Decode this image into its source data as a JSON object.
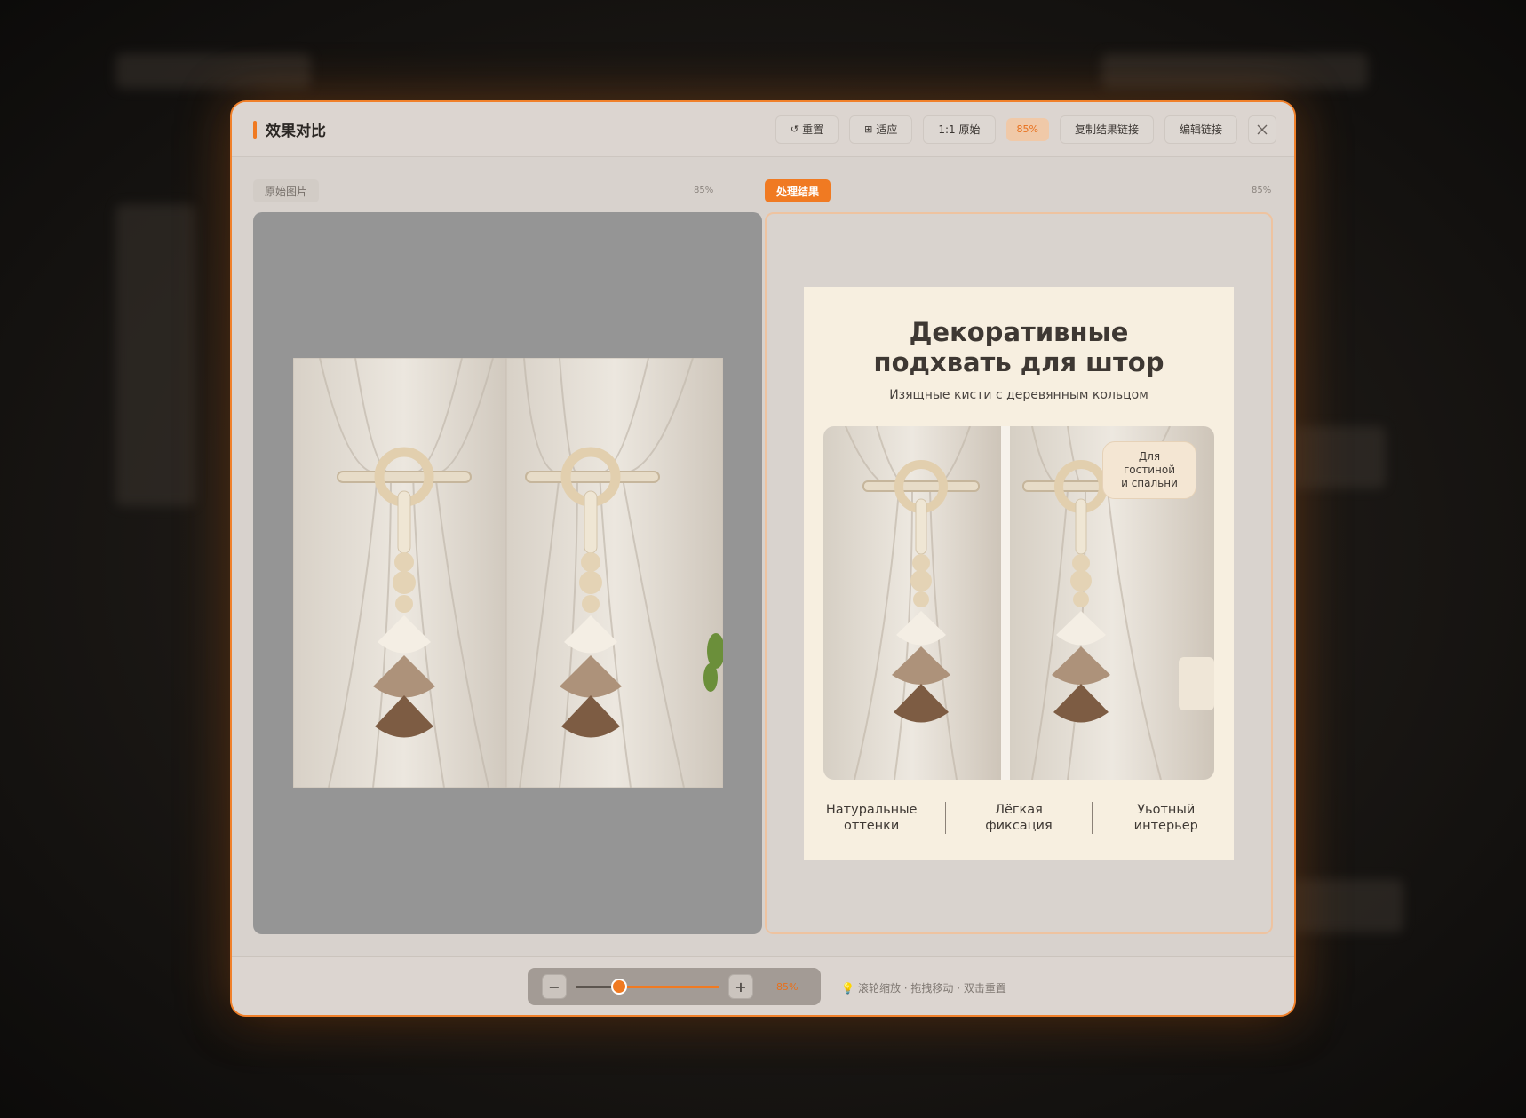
{
  "modal": {
    "title": "效果对比",
    "toolbar": {
      "reset_label": "重置",
      "fit_label": "适应",
      "actual_label": "1:1 原始",
      "zoom_display": "85%",
      "copy_link_label": "复制结果链接",
      "edit_link_label": "编辑链接"
    }
  },
  "panels": {
    "original": {
      "label": "原始图片",
      "zoom": "85%"
    },
    "result": {
      "label": "处理结果",
      "zoom": "85%"
    }
  },
  "poster": {
    "title_line1": "Декоративные",
    "title_line2": "подхвать для штор",
    "subtitle": "Изящные кисти с деревянным кольцом",
    "badge": "Для\nгостиной\nи спальни",
    "features": [
      "Натуральные\nоттенки",
      "Лёгкая\nфиксация",
      "Уьотный\nинтерьер"
    ]
  },
  "footer": {
    "zoom_value": "85%",
    "zoom_fraction": 0.3,
    "hint": "滚轮缩放 · 拖拽移动 · 双击重置"
  },
  "colors": {
    "accent": "#f07a22",
    "modal_bg": "#d8d2cd",
    "poster_bg": "#f7efe0"
  }
}
